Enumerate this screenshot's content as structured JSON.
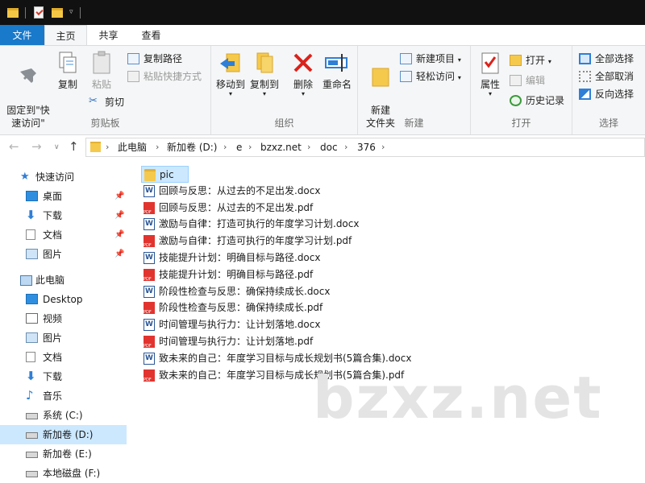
{
  "ribbon_tabs": {
    "file": "文件",
    "home": "主页",
    "share": "共享",
    "view": "查看"
  },
  "ribbon": {
    "clipboard": {
      "label": "剪贴板",
      "pin": "固定到\"快\n速访问\"",
      "copy": "复制",
      "paste": "粘贴",
      "copy_path": "复制路径",
      "paste_shortcut": "粘贴快捷方式",
      "cut": "剪切"
    },
    "organize": {
      "label": "组织",
      "move_to": "移动到",
      "copy_to": "复制到",
      "delete": "删除",
      "rename": "重命名"
    },
    "new": {
      "label": "新建",
      "new_folder": "新建\n文件夹",
      "new_item": "新建项目",
      "easy_access": "轻松访问"
    },
    "open": {
      "label": "打开",
      "properties": "属性",
      "open": "打开",
      "edit": "编辑",
      "history": "历史记录"
    },
    "select": {
      "label": "选择",
      "select_all": "全部选择",
      "select_none": "全部取消",
      "invert": "反向选择"
    }
  },
  "breadcrumb": [
    "此电脑",
    "新加卷 (D:)",
    "e",
    "bzxz.net",
    "doc",
    "376"
  ],
  "nav": {
    "quick_access": "快速访问",
    "quick_items": [
      "桌面",
      "下载",
      "文档",
      "图片"
    ],
    "this_pc": "此电脑",
    "pc_items": [
      "Desktop",
      "视频",
      "图片",
      "文档",
      "下载",
      "音乐",
      "系统 (C:)",
      "新加卷 (D:)",
      "新加卷 (E:)",
      "本地磁盘 (F:)"
    ]
  },
  "files": [
    {
      "name": "pic",
      "type": "folder"
    },
    {
      "name": "回顾与反思：从过去的不足出发.docx",
      "type": "docx"
    },
    {
      "name": "回顾与反思：从过去的不足出发.pdf",
      "type": "pdf"
    },
    {
      "name": "激励与自律：打造可执行的年度学习计划.docx",
      "type": "docx"
    },
    {
      "name": "激励与自律：打造可执行的年度学习计划.pdf",
      "type": "pdf"
    },
    {
      "name": "技能提升计划：明确目标与路径.docx",
      "type": "docx"
    },
    {
      "name": "技能提升计划：明确目标与路径.pdf",
      "type": "pdf"
    },
    {
      "name": "阶段性检查与反思：确保持续成长.docx",
      "type": "docx"
    },
    {
      "name": "阶段性检查与反思：确保持续成长.pdf",
      "type": "pdf"
    },
    {
      "name": "时间管理与执行力：让计划落地.docx",
      "type": "docx"
    },
    {
      "name": "时间管理与执行力：让计划落地.pdf",
      "type": "pdf"
    },
    {
      "name": "致未来的自己：年度学习目标与成长规划书(5篇合集).docx",
      "type": "docx"
    },
    {
      "name": "致未来的自己：年度学习目标与成长规划书(5篇合集).pdf",
      "type": "pdf"
    }
  ],
  "watermark": "bzxz.net"
}
